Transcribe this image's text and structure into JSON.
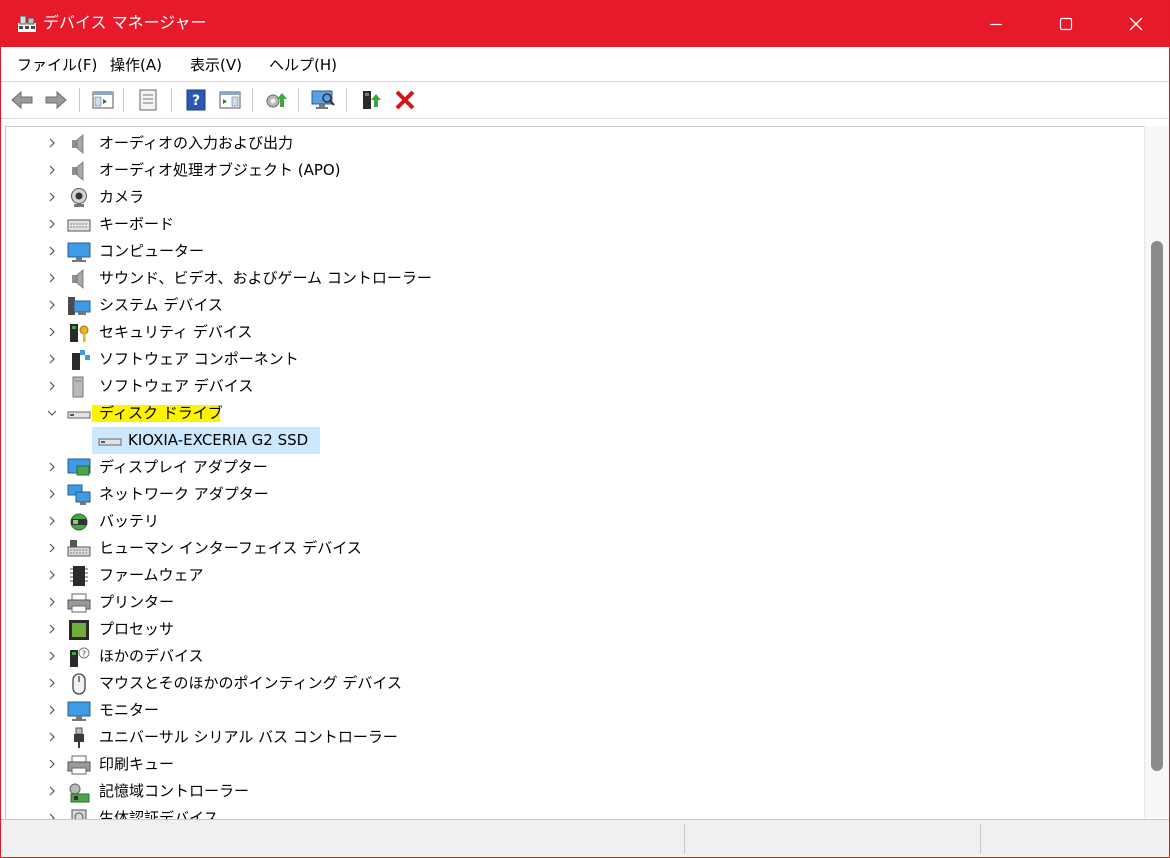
{
  "window": {
    "title": "デバイス マネージャー",
    "accent_color": "#e8192a",
    "icon": "device-manager-icon",
    "controls": [
      "minimize-icon",
      "maximize-icon",
      "close-icon"
    ]
  },
  "menu": [
    {
      "label": "ファイル(F)"
    },
    {
      "label": "操作(A)"
    },
    {
      "label": "表示(V)"
    },
    {
      "label": "ヘルプ(H)"
    }
  ],
  "toolbar": [
    "back-arrow-icon",
    "forward-arrow-icon",
    "show-hide-console-tree-icon",
    "properties-icon",
    "help-icon",
    "action-pane-icon",
    "update-driver-icon",
    "scan-hardware-changes-icon",
    "enable-device-icon",
    "uninstall-device-icon"
  ],
  "tree": {
    "items": [
      {
        "label": "オーディオの入力および出力",
        "icon": "audio-io-icon",
        "expanded": false
      },
      {
        "label": "オーディオ処理オブジェクト (APO)",
        "icon": "audio-apo-icon",
        "expanded": false
      },
      {
        "label": "カメラ",
        "icon": "camera-icon",
        "expanded": false
      },
      {
        "label": "キーボード",
        "icon": "keyboard-icon",
        "expanded": false
      },
      {
        "label": "コンピューター",
        "icon": "computer-icon",
        "expanded": false
      },
      {
        "label": "サウンド、ビデオ、およびゲーム コントローラー",
        "icon": "sound-video-icon",
        "expanded": false
      },
      {
        "label": "システム デバイス",
        "icon": "system-devices-icon",
        "expanded": false
      },
      {
        "label": "セキュリティ デバイス",
        "icon": "security-devices-icon",
        "expanded": false
      },
      {
        "label": "ソフトウェア コンポーネント",
        "icon": "software-component-icon",
        "expanded": false
      },
      {
        "label": "ソフトウェア デバイス",
        "icon": "software-devices-icon",
        "expanded": false
      },
      {
        "label": "ディスク ドライブ",
        "icon": "disk-drive-icon",
        "expanded": true,
        "highlight_color": "#fff200",
        "children": [
          {
            "label": "KIOXIA-EXCERIA G2 SSD",
            "icon": "disk-drive-icon",
            "selected": true,
            "selection_color": "#cce8ff"
          }
        ]
      },
      {
        "label": "ディスプレイ アダプター",
        "icon": "display-adapter-icon",
        "expanded": false
      },
      {
        "label": "ネットワーク アダプター",
        "icon": "network-adapter-icon",
        "expanded": false
      },
      {
        "label": "バッテリ",
        "icon": "battery-icon",
        "expanded": false
      },
      {
        "label": "ヒューマン インターフェイス デバイス",
        "icon": "hid-icon",
        "expanded": false
      },
      {
        "label": "ファームウェア",
        "icon": "firmware-icon",
        "expanded": false
      },
      {
        "label": "プリンター",
        "icon": "printer-icon",
        "expanded": false
      },
      {
        "label": "プロセッサ",
        "icon": "processor-icon",
        "expanded": false
      },
      {
        "label": "ほかのデバイス",
        "icon": "other-devices-icon",
        "expanded": false
      },
      {
        "label": "マウスとそのほかのポインティング デバイス",
        "icon": "mouse-icon",
        "expanded": false
      },
      {
        "label": "モニター",
        "icon": "monitor-icon",
        "expanded": false
      },
      {
        "label": "ユニバーサル シリアル バス コントローラー",
        "icon": "usb-icon",
        "expanded": false
      },
      {
        "label": "印刷キュー",
        "icon": "print-queue-icon",
        "expanded": false
      },
      {
        "label": "記憶域コントローラー",
        "icon": "storage-controller-icon",
        "expanded": false
      },
      {
        "label": "生体認証デバイス",
        "icon": "biometric-icon",
        "expanded": false
      }
    ]
  },
  "statusbar": {
    "sections": [
      "",
      "",
      ""
    ]
  }
}
